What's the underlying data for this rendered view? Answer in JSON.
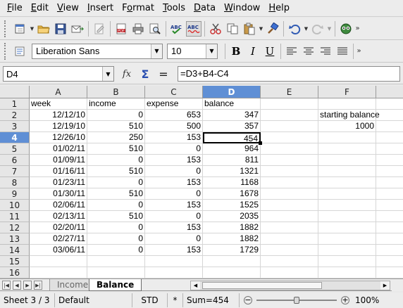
{
  "menu": [
    "File",
    "Edit",
    "View",
    "Insert",
    "Format",
    "Tools",
    "Data",
    "Window",
    "Help"
  ],
  "formatting": {
    "font_name": "Liberation Sans",
    "font_size": "10",
    "bold_label": "B",
    "italic_label": "I",
    "underline_label": "U"
  },
  "formula_bar": {
    "cell_ref": "D4",
    "formula": "=D3+B4-C4",
    "fx_label": "fx",
    "sum_label": "Σ",
    "equals_label": "="
  },
  "sheet": {
    "columns": [
      "A",
      "B",
      "C",
      "D",
      "E",
      "F"
    ],
    "selected_column": "D",
    "selected_row": "4",
    "headers": [
      "week",
      "income",
      "expense",
      "balance"
    ],
    "rows": [
      {
        "week": "12/12/10",
        "income": "0",
        "expense": "653",
        "balance": "347"
      },
      {
        "week": "12/19/10",
        "income": "510",
        "expense": "500",
        "balance": "357"
      },
      {
        "week": "12/26/10",
        "income": "250",
        "expense": "153",
        "balance": "454"
      },
      {
        "week": "01/02/11",
        "income": "510",
        "expense": "0",
        "balance": "964"
      },
      {
        "week": "01/09/11",
        "income": "0",
        "expense": "153",
        "balance": "811"
      },
      {
        "week": "01/16/11",
        "income": "510",
        "expense": "0",
        "balance": "1321"
      },
      {
        "week": "01/23/11",
        "income": "0",
        "expense": "153",
        "balance": "1168"
      },
      {
        "week": "01/30/11",
        "income": "510",
        "expense": "0",
        "balance": "1678"
      },
      {
        "week": "02/06/11",
        "income": "0",
        "expense": "153",
        "balance": "1525"
      },
      {
        "week": "02/13/11",
        "income": "510",
        "expense": "0",
        "balance": "2035"
      },
      {
        "week": "02/20/11",
        "income": "0",
        "expense": "153",
        "balance": "1882"
      },
      {
        "week": "02/27/11",
        "income": "0",
        "expense": "0",
        "balance": "1882"
      },
      {
        "week": "03/06/11",
        "income": "0",
        "expense": "153",
        "balance": "1729"
      }
    ],
    "row_numbers": [
      "1",
      "2",
      "3",
      "4",
      "5",
      "6",
      "7",
      "8",
      "9",
      "10",
      "11",
      "12",
      "13",
      "14",
      "15",
      "16"
    ],
    "side_note": {
      "label": "starting balance",
      "value": "1000"
    }
  },
  "tabs": {
    "items": [
      "Income",
      "Balance"
    ],
    "active": "Balance"
  },
  "status": {
    "sheet": "Sheet 3 / 3",
    "style": "Default",
    "mode": "STD",
    "modified": "*",
    "sum": "Sum=454",
    "zoom_minus": "−",
    "zoom_plus": "+",
    "zoom": "100%",
    "zoom_level": 0.5
  },
  "colors": {
    "selection_header": "#5f8fd5",
    "active_tab": "#ffffff",
    "chrome": "#ececec"
  },
  "icons": {
    "toolbar1": [
      "new-document-icon",
      "open-folder-icon",
      "save-icon",
      "email-icon",
      "edit-file-icon",
      "export-pdf-icon",
      "print-icon",
      "page-preview-icon",
      "spellcheck-icon",
      "autospellcheck-icon",
      "cut-icon",
      "copy-icon",
      "paste-icon",
      "clone-formatting-icon",
      "undo-icon",
      "redo-icon",
      "navigator-icon"
    ],
    "toolbar2": [
      "align-left-icon",
      "align-center-icon",
      "align-right-icon",
      "justify-icon"
    ]
  }
}
